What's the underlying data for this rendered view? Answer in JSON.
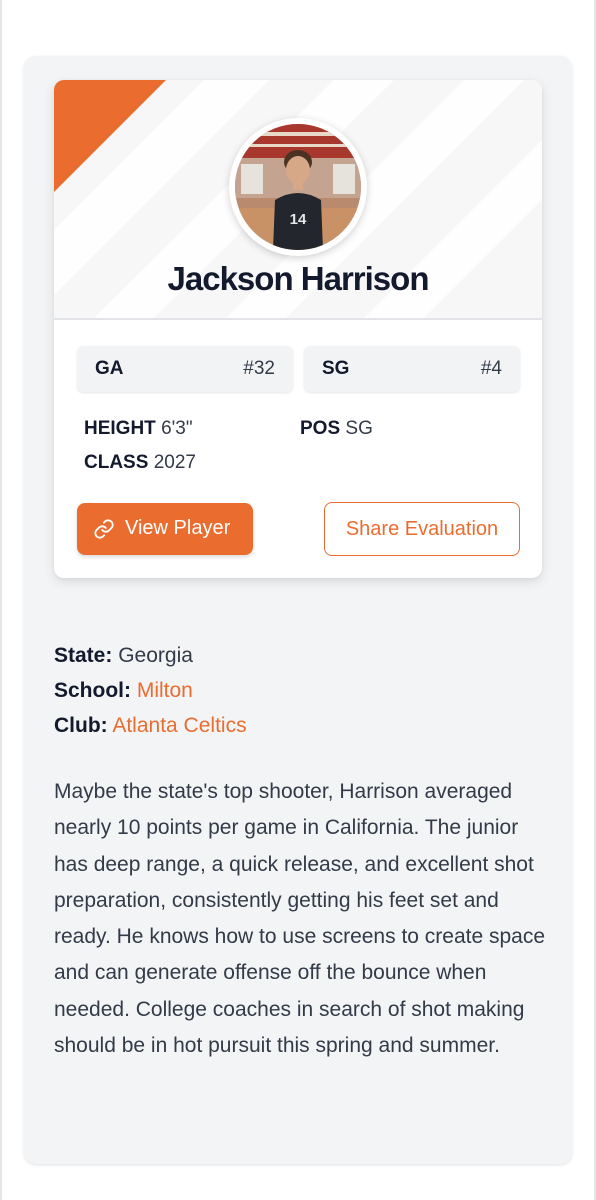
{
  "colors": {
    "accent": "#ea6d2f",
    "heading": "#141a2e",
    "text": "#333a48",
    "panel": "#f3f4f6"
  },
  "player": {
    "name": "Jackson Harrison",
    "jersey_number": "14",
    "avatar_icon": "player-photo"
  },
  "rankings": [
    {
      "label": "GA",
      "value": "#32"
    },
    {
      "label": "SG",
      "value": "#4"
    }
  ],
  "stats": {
    "height_label": "HEIGHT",
    "height_value": "6'3\"",
    "pos_label": "POS",
    "pos_value": "SG",
    "class_label": "CLASS",
    "class_value": "2027"
  },
  "actions": {
    "view_icon": "link-icon",
    "view_label": "View Player",
    "share_label": "Share Evaluation"
  },
  "details": {
    "state_label": "State:",
    "state_value": "Georgia",
    "school_label": "School:",
    "school_value": "Milton",
    "club_label": "Club:",
    "club_value": "Atlanta Celtics"
  },
  "evaluation": "Maybe the state's top shooter, Harrison averaged nearly 10 points per game in California. The junior has deep range, a quick release, and excellent shot preparation, consistently getting his feet set and ready. He knows how to use screens to create space and can generate offense off the bounce when needed. College coaches in search of shot making should be in hot pursuit this spring and summer."
}
